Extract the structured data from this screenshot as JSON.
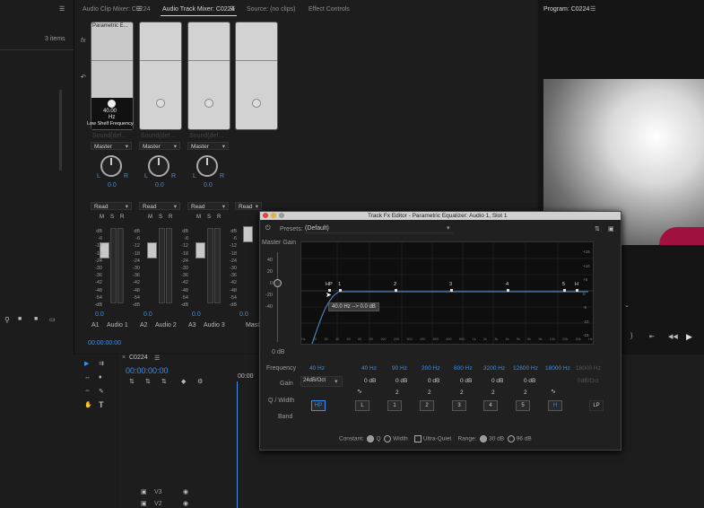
{
  "left_panel": {
    "count": "3 items"
  },
  "tabs": [
    "Audio Clip Mixer: C0224",
    "Audio Track Mixer: C0224",
    "Source: (no clips)",
    "Effect Controls"
  ],
  "program": {
    "title": "Program: C0224"
  },
  "mixer": {
    "fx_label": "fx",
    "effect_name": "Parametric E...",
    "knob_value": "40.00",
    "knob_unit": "Hz",
    "knob_param": "Low Shelf Frequency",
    "send_ghost": "Sound(def...",
    "output": "Master",
    "automation": "Read",
    "ms": [
      "M",
      "S",
      "R"
    ],
    "pan_left": "L",
    "pan_right": "R",
    "pan_value": "0.0",
    "db_scale": [
      "dB",
      "-6",
      "-12",
      "-18",
      "-24",
      "-30",
      "-36",
      "-42",
      "-48",
      "-54",
      "-dB"
    ],
    "fader_value": "0.0",
    "tracks": [
      {
        "id": "A1",
        "name": "Audio 1"
      },
      {
        "id": "A2",
        "name": "Audio 2"
      },
      {
        "id": "A3",
        "name": "Audio 3"
      }
    ],
    "master_label": "Mast",
    "timecode": "00:00:00:00"
  },
  "editor": {
    "title": "Track Fx Editor - Parametric Equalizer: Audio 1, Slot 1",
    "presets_label": "Presets:",
    "preset_value": "(Default)",
    "master_gain_label": "Master Gain",
    "master_gain_scale": [
      "40",
      "20",
      "0",
      "-20",
      "-40"
    ],
    "master_gain_value": "0 dB",
    "db_right": [
      "+15",
      "+10",
      "+5",
      "0",
      "-5",
      "-10",
      "-15"
    ],
    "freq_scale": [
      "Hz",
      "20",
      "30",
      "40",
      "50",
      "60",
      "80",
      "100",
      "200",
      "300",
      "400",
      "500",
      "600",
      "800",
      "1k",
      "2k",
      "3k",
      "4k",
      "5k",
      "6k",
      "8k",
      "10k",
      "20k",
      "30k",
      "Hz"
    ],
    "points": [
      "HP",
      "1",
      "2",
      "3",
      "4",
      "5",
      "H"
    ],
    "tooltip": "40.0 Hz --> 0.0 dB",
    "frequency_label": "Frequency",
    "gain_label": "Gain",
    "q_label": "Q / Width",
    "band_label": "Band",
    "hp_freq": "40 Hz",
    "frequencies": [
      "40 Hz",
      "90 Hz",
      "200 Hz",
      "800 Hz",
      "3200 Hz",
      "12800 Hz",
      "18000 Hz",
      "18000 Hz"
    ],
    "slope": "24dB/Oct",
    "gains": [
      "0 dB",
      "0 dB",
      "0 dB",
      "0 dB",
      "0 dB",
      "0 dB",
      "0dB/Oct"
    ],
    "qs": [
      "2",
      "2",
      "2",
      "2",
      "2"
    ],
    "bands": [
      "HP",
      "L",
      "1",
      "2",
      "3",
      "4",
      "5",
      "H",
      "LP"
    ],
    "constant_label": "Constant:",
    "q_option": "Q",
    "width_option": "Width",
    "ultra_quiet": "Ultra-Quiet",
    "range_label": "Range:",
    "range_30": "30 dB",
    "range_96": "96 dB"
  },
  "timeline": {
    "title": "C0224",
    "timecode": "00:00:00:00",
    "ruler": "00:00",
    "track_v3": "V3",
    "track_v2": "V2"
  }
}
